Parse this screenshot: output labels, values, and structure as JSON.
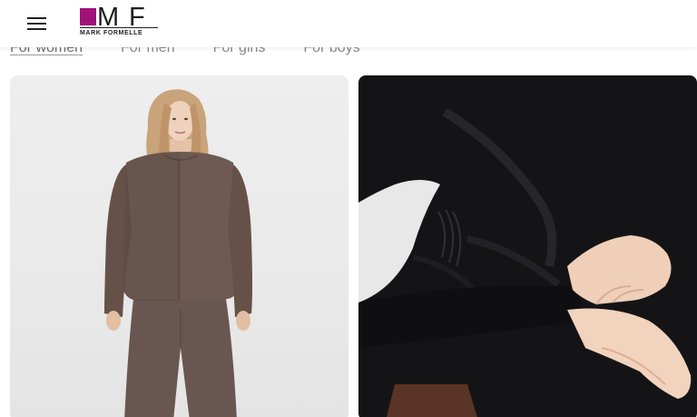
{
  "brand": {
    "name": "MARK FORMELLE",
    "logo_letter_m": "M",
    "logo_letter_f": "F",
    "accent_color": "#a1117a"
  },
  "header": {
    "menu_icon": "hamburger-menu-icon"
  },
  "tabs": [
    {
      "label": "For women",
      "active": true
    },
    {
      "label": "For men",
      "active": false
    },
    {
      "label": "For girls",
      "active": false
    },
    {
      "label": "For boys",
      "active": false
    }
  ],
  "products": [
    {
      "image": "woman in brown long-sleeve top and wide trousers"
    },
    {
      "image": "black draped long-sleeve top, close-up of hand and cuff"
    }
  ]
}
